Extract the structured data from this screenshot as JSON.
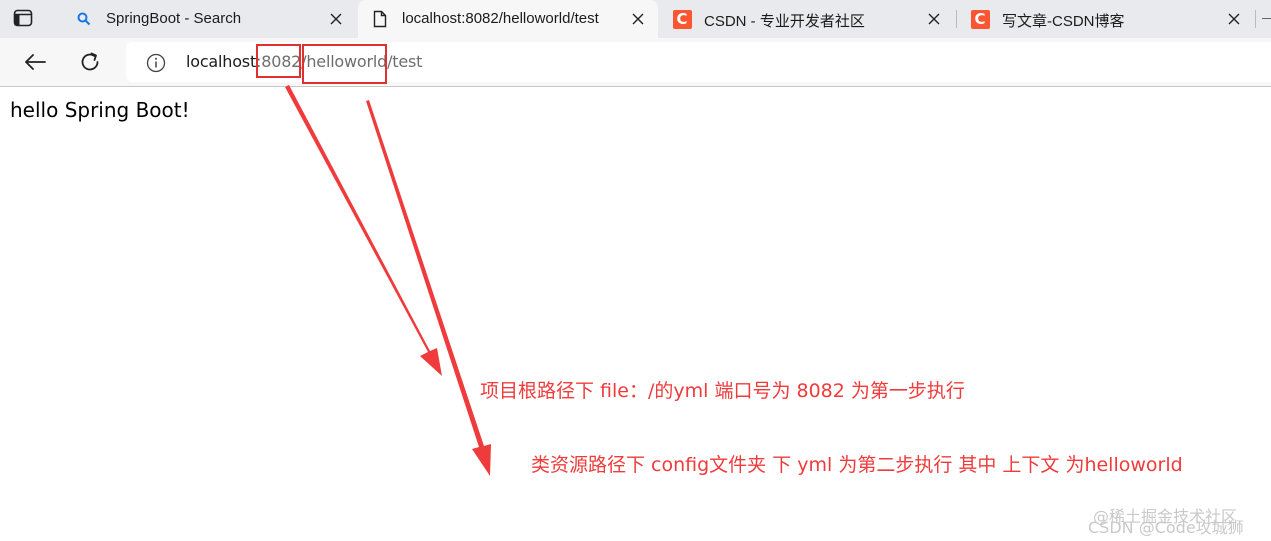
{
  "tabs": [
    {
      "title": "SpringBoot - Search",
      "icon": "search-icon",
      "active": false
    },
    {
      "title": "localhost:8082/helloworld/test",
      "icon": "page-icon",
      "active": true
    },
    {
      "title": "CSDN - 专业开发者社区",
      "icon": "csdn-logo-icon",
      "active": false
    },
    {
      "title": "写文章-CSDN博客",
      "icon": "csdn-logo-icon",
      "active": false
    }
  ],
  "csdn_logo_letter": "C",
  "address": {
    "host": "localhost",
    "colon": ":",
    "port": "8082",
    "slash1": "/",
    "context": "helloworld",
    "path": "/test"
  },
  "page": {
    "body_text": "hello Spring Boot!"
  },
  "annotations": {
    "step1": "项目根路径下 file：/的yml 端口号为 8082 为第一步执行",
    "step2": "类资源路径下 config文件夹 下 yml 为第二步执行 其中 上下文 为helloworld"
  },
  "watermark": {
    "line1": "@稀土掘金技术社区",
    "line2": "CSDN @Code攻城狮"
  },
  "colors": {
    "annotation_red": "#ef3b3b",
    "csdn_orange": "#fc5531",
    "tabbar_bg": "#e9eaed"
  }
}
